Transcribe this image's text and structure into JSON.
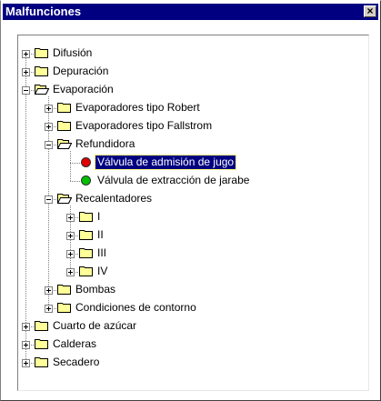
{
  "window": {
    "title": "Malfunciones",
    "close_label": "×"
  },
  "colors": {
    "titlebar": "#000080",
    "folder": "#ffff99",
    "folder_outline": "#000000",
    "selection": "#000080",
    "status_red": "#e00000",
    "status_green": "#00c000"
  },
  "tree": {
    "items": [
      {
        "label": "Difusión",
        "level": 0,
        "type": "folder",
        "expanded": false
      },
      {
        "label": "Depuración",
        "level": 0,
        "type": "folder",
        "expanded": false
      },
      {
        "label": "Evaporación",
        "level": 0,
        "type": "folder",
        "expanded": true
      },
      {
        "label": "Evaporadores tipo Robert",
        "level": 1,
        "type": "folder",
        "expanded": false
      },
      {
        "label": "Evaporadores tipo Fallstrom",
        "level": 1,
        "type": "folder",
        "expanded": false
      },
      {
        "label": "Refundidora",
        "level": 1,
        "type": "folder",
        "expanded": true
      },
      {
        "label": "Válvula de admisión de jugo",
        "level": 2,
        "type": "leaf",
        "status": "red",
        "selected": true
      },
      {
        "label": "Válvula de extracción de jarabe",
        "level": 2,
        "type": "leaf",
        "status": "green",
        "selected": false
      },
      {
        "label": "Recalentadores",
        "level": 1,
        "type": "folder",
        "expanded": true
      },
      {
        "label": "I",
        "level": 2,
        "type": "folder",
        "expanded": false
      },
      {
        "label": "II",
        "level": 2,
        "type": "folder",
        "expanded": false
      },
      {
        "label": "III",
        "level": 2,
        "type": "folder",
        "expanded": false
      },
      {
        "label": "IV",
        "level": 2,
        "type": "folder",
        "expanded": false
      },
      {
        "label": "Bombas",
        "level": 1,
        "type": "folder",
        "expanded": false
      },
      {
        "label": "Condiciones de contorno",
        "level": 1,
        "type": "folder",
        "expanded": false
      },
      {
        "label": "Cuarto de azúcar",
        "level": 0,
        "type": "folder",
        "expanded": false
      },
      {
        "label": "Calderas",
        "level": 0,
        "type": "folder",
        "expanded": false
      },
      {
        "label": "Secadero",
        "level": 0,
        "type": "folder",
        "expanded": false
      }
    ]
  }
}
